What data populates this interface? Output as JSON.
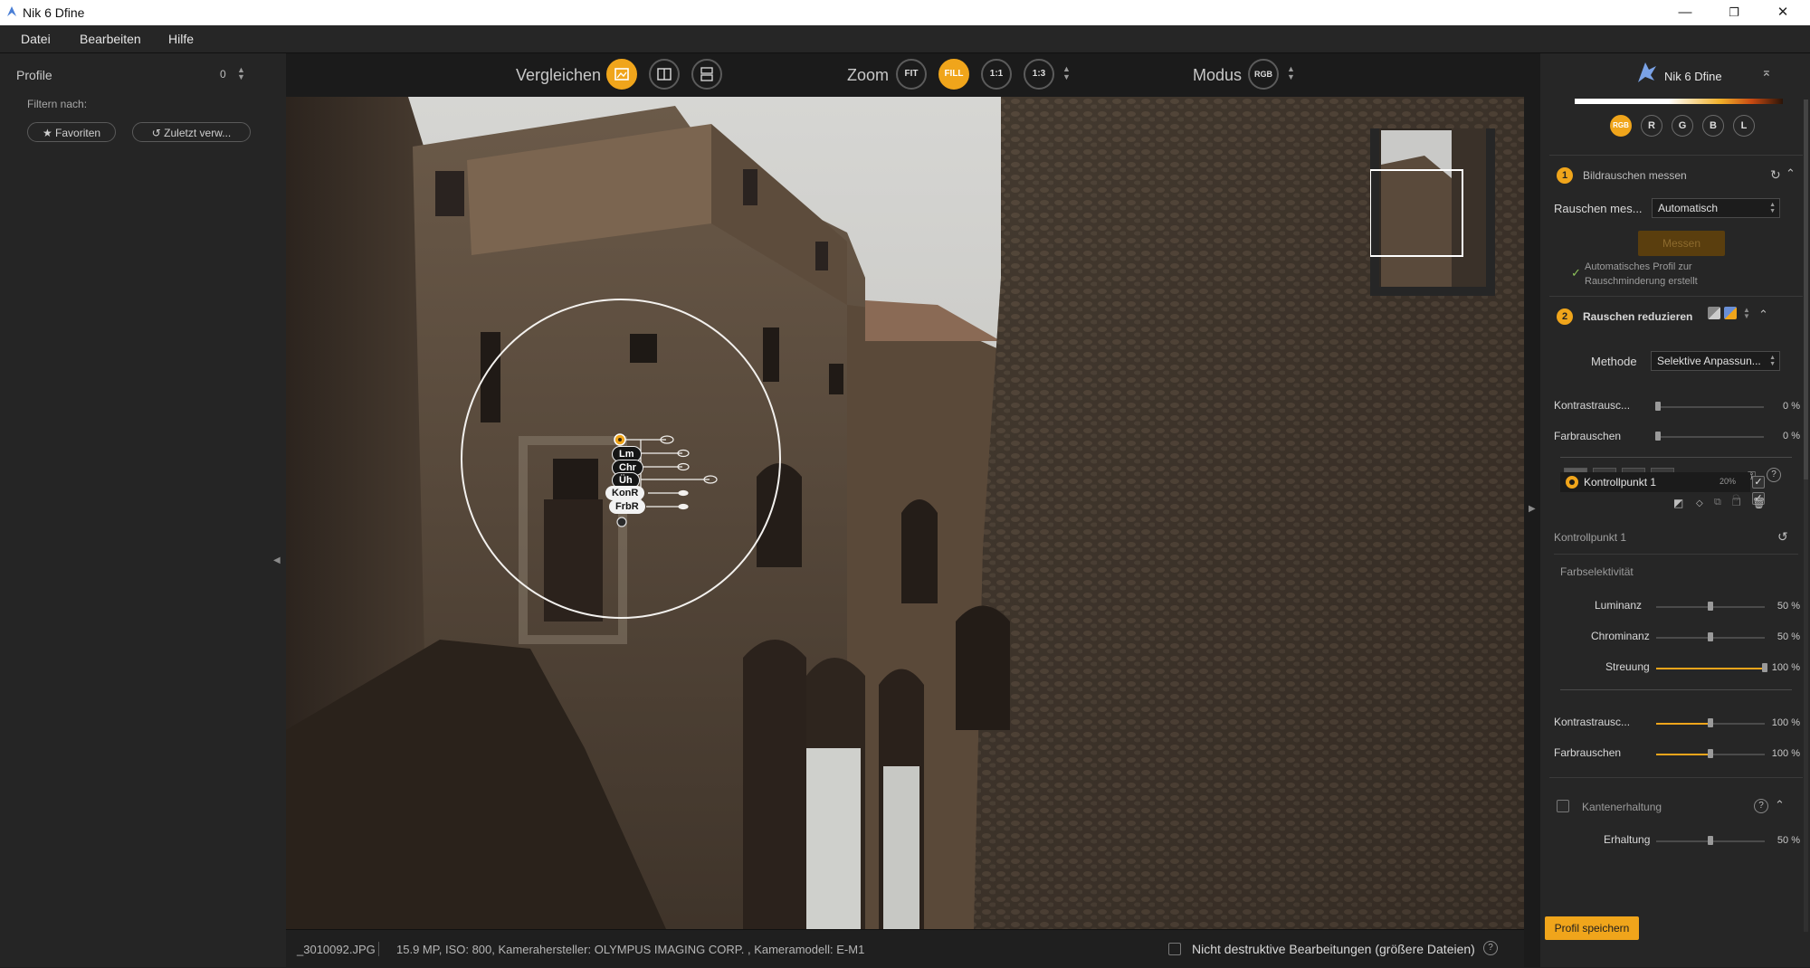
{
  "window": {
    "title": "Nik 6 Dfine",
    "controls": {
      "minimize": "—",
      "maximize": "❐",
      "close": "✕"
    }
  },
  "menu": [
    "Datei",
    "Bearbeiten",
    "Hilfe"
  ],
  "left_panel": {
    "profiles_label": "Profile",
    "profiles_count": "0",
    "filter_label": "Filtern nach:",
    "favorites_button": "★ Favoriten",
    "recent_button": "↺ Zuletzt verw..."
  },
  "toolbar": {
    "compare_label": "Vergleichen",
    "zoom_label": "Zoom",
    "zoom_options": [
      "FIT",
      "FILL",
      "1:1",
      "1:3"
    ],
    "zoom_active": "FILL",
    "mode_label": "Modus",
    "mode_value": "RGB"
  },
  "control_point": {
    "labels": [
      "Lm",
      "Chr",
      "Üh",
      "KonR",
      "FrbR"
    ]
  },
  "status": {
    "filename": "_3010092.JPG",
    "info": "15.9 MP, ISO: 800, Kamerahersteller: OLYMPUS IMAGING CORP.  , Kameramodell: E-M1",
    "nondestructive": "Nicht destruktive Bearbeitungen (größere Dateien)",
    "help": "?"
  },
  "right_panel": {
    "app_name": "Nik 6 Dfine",
    "channels": [
      "RGB",
      "R",
      "G",
      "B",
      "L"
    ],
    "step1": {
      "number": "1",
      "title": "Bildrauschen messen",
      "measure_label": "Rauschen mes...",
      "measure_value": "Automatisch",
      "measure_button": "Messen",
      "note_line1": "Automatisches Profil zur",
      "note_line2": "Rauschminderung erstellt"
    },
    "step2": {
      "number": "2",
      "title": "Rauschen reduzieren",
      "method_label": "Methode",
      "method_value": "Selektive Anpassun...",
      "sliders": [
        {
          "label": "Kontrastrausc...",
          "value": "0 %",
          "level": 0
        },
        {
          "label": "Farbrauschen",
          "value": "0 %",
          "level": 0
        }
      ]
    },
    "control_point": {
      "name": "Kontrollpunkt 1",
      "size": "20%",
      "detail_title": "Kontrollpunkt 1"
    },
    "color_selectivity": {
      "title": "Farbselektivität",
      "sliders": [
        {
          "label": "Luminanz",
          "value": "50 %",
          "level": 50,
          "highlight": false
        },
        {
          "label": "Chrominanz",
          "value": "50 %",
          "level": 50,
          "highlight": false
        },
        {
          "label": "Streuung",
          "value": "100 %",
          "level": 100,
          "highlight": true
        }
      ]
    },
    "cp_sliders": [
      {
        "label": "Kontrastrausc...",
        "value": "100 %",
        "level": 50
      },
      {
        "label": "Farbrauschen",
        "value": "100 %",
        "level": 50
      }
    ],
    "edge": {
      "title": "Kantenerhaltung",
      "label": "Erhaltung",
      "value": "50 %"
    },
    "save_button": "Profil speichern"
  },
  "colors": {
    "accent": "#f0a51b",
    "background": "#1e1e1e",
    "panel": "#262626"
  }
}
